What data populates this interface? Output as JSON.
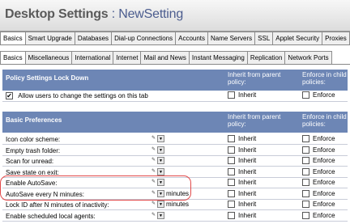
{
  "title": {
    "main": "Desktop Settings",
    "sub": " : NewSetting"
  },
  "tabs_row1": [
    "Basics",
    "Smart Upgrade",
    "Databases",
    "Dial-up Connections",
    "Accounts",
    "Name Servers",
    "SSL",
    "Applet Security",
    "Proxies"
  ],
  "tabs_row2": [
    "Basics",
    "Miscellaneous",
    "International",
    "Internet",
    "Mail and News",
    "Instant Messaging",
    "Replication",
    "Network Ports"
  ],
  "lock_section": {
    "title": "Policy Settings Lock Down",
    "col_inherit": "Inherit from parent policy:",
    "col_enforce": "Enforce in child policies:",
    "allow_label": "Allow users to change the settings on this tab",
    "inherit": "Inherit",
    "enforce": "Enforce"
  },
  "prefs_section": {
    "title": "Basic Preferences",
    "col_inherit": "Inherit from parent policy:",
    "col_enforce": "Enforce in child policies:",
    "rows": [
      {
        "label": "Icon color scheme:",
        "unit": ""
      },
      {
        "label": "Empty trash folder:",
        "unit": ""
      },
      {
        "label": "Scan for unread:",
        "unit": ""
      },
      {
        "label": "Save state on exit:",
        "unit": ""
      },
      {
        "label": "Enable AutoSave:",
        "unit": ""
      },
      {
        "label": "AutoSave every N minutes:",
        "unit": "minutes"
      },
      {
        "label": "Lock ID after N minutes of inactivity:",
        "unit": "minutes"
      },
      {
        "label": "Enable scheduled local agents:",
        "unit": ""
      }
    ],
    "inherit": "Inherit",
    "enforce": "Enforce"
  },
  "icons": {
    "edit": "pencil-icon",
    "dropdown": "dropdown-arrow-icon",
    "check": "checkmark-icon"
  },
  "colors": {
    "section_header_bg": "#6d86b5",
    "highlight_border": "#e24a4a"
  }
}
